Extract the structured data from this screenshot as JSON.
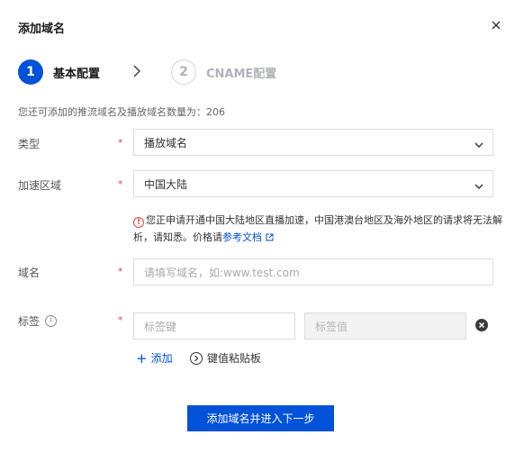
{
  "dialog": {
    "title": "添加域名",
    "close_icon": "close-icon"
  },
  "steps": [
    {
      "number": "1",
      "label": "基本配置",
      "state": "active"
    },
    {
      "number": "2",
      "label": "CNAME配置",
      "state": "inactive"
    }
  ],
  "quota_text": "您还可添加的推流域名及播放域名数量为：206",
  "form": {
    "type": {
      "label": "类型",
      "required_mark": "*",
      "value": "播放域名"
    },
    "region": {
      "label": "加速区域",
      "required_mark": "*",
      "value": "中国大陆"
    },
    "warning": {
      "text": "您正申请开通中国大陆地区直播加速，中国港澳台地区及海外地区的请求将无法解析，请知悉。价格请",
      "link": "参考文档",
      "icon_char": "!"
    },
    "domain": {
      "label": "域名",
      "required_mark": "*",
      "placeholder": "请填写域名，如:www.test.com"
    },
    "tag": {
      "label": "标签",
      "info_char": "i",
      "required_mark": "*",
      "key_placeholder": "标签键",
      "value_placeholder": "标签值",
      "add_label": "添加",
      "add_symbol": "+",
      "paste_label": "键值粘贴板"
    }
  },
  "submit_label": "添加域名并进入下一步",
  "colors": {
    "primary": "#0052d9",
    "required": "#e54545"
  }
}
